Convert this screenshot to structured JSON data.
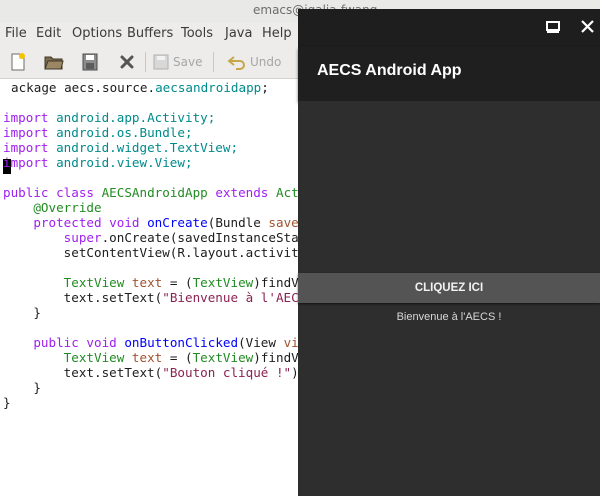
{
  "emacs": {
    "window_title": "emacs@igalia-fwang",
    "menus": [
      "File",
      "Edit",
      "Options",
      "Buffers",
      "Tools",
      "Java",
      "Help"
    ],
    "toolbar": {
      "new_file_icon": "new-file-icon",
      "open_icon": "folder-open-icon",
      "save_disk_icon": "save-disk-icon",
      "close_icon": "close-x-icon",
      "save_label": "Save",
      "undo_label": "Undo"
    },
    "code": {
      "l1a": "ackage ",
      "l1b": "aecs.source.",
      "l1c": "aecsandroidapp",
      "l1d": ";",
      "l3a": "import ",
      "l3b": "android.app.Activity;",
      "l4a": "import ",
      "l4b": "android.os.Bundle;",
      "l5a": "import ",
      "l5b": "android.widget.TextView;",
      "l6a": "import ",
      "l6b": "android.view.View;",
      "l8a": "public class ",
      "l8b": "AECSAndroidApp",
      "l8c": " extends ",
      "l8d": "Activity {",
      "l9": "    @Override",
      "l10a": "    protected void ",
      "l10b": "onCreate",
      "l10c": "(Bundle ",
      "l10d": "savedInstanceState) {",
      "l11a": "        super",
      "l11b": ".onCreate(savedInstanceState);",
      "l12": "        setContentView(R.layout.activity_main);",
      "l14a": "        TextView ",
      "l14b": "text",
      "l14c": " = (",
      "l14d": "TextView",
      "l14e": ")findViewById(R.id.text);",
      "l15a": "        text.setText(",
      "l15b": "\"Bienvenue à l'AECS !\"",
      "l15c": ");",
      "l16": "    }",
      "l18a": "    public void ",
      "l18b": "onButtonClicked",
      "l18c": "(View ",
      "l18d": "view) {",
      "l19a": "        TextView ",
      "l19b": "text",
      "l19c": " = (",
      "l19d": "TextView",
      "l19e": ")findViewById(R.id.text);",
      "l20a": "        text.setText(",
      "l20b": "\"Bouton cliqué !\"",
      "l20c": ");",
      "l21": "    }",
      "l22": "}"
    }
  },
  "emulator": {
    "minimize_icon": "minimize-icon",
    "close_icon": "close-icon",
    "app_title": "AECS Android App",
    "button_label": "CLIQUEZ ICI",
    "message": "Bienvenue à l'AECS !"
  },
  "colors": {
    "keyword": "#a020f0",
    "type": "#228b22",
    "function": "#0000ff",
    "string": "#8b2252",
    "app_bar": "#1f1f1f",
    "app_background": "#2e2e2e",
    "button": "#545454"
  }
}
